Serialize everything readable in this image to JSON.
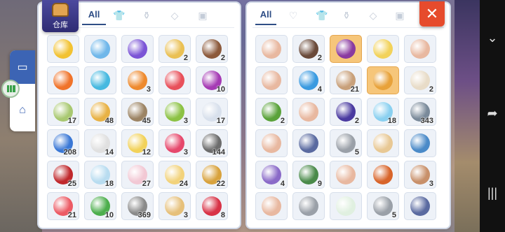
{
  "left_panel": {
    "badge_label": "仓库",
    "tabs": [
      {
        "label": "All",
        "active": true
      },
      {
        "icon": "shirt-icon"
      },
      {
        "icon": "potion-icon"
      },
      {
        "icon": "gem-icon"
      },
      {
        "icon": "card-icon"
      }
    ],
    "items": [
      {
        "color": "#f2c232",
        "qty": ""
      },
      {
        "color": "#6fb7ea",
        "qty": ""
      },
      {
        "color": "#7b54d6",
        "qty": ""
      },
      {
        "color": "#eac054",
        "qty": "2"
      },
      {
        "color": "#8c5a3c",
        "qty": "2"
      },
      {
        "color": "#f0732a",
        "qty": ""
      },
      {
        "color": "#46b9e0",
        "qty": ""
      },
      {
        "color": "#ee8a2e",
        "qty": "3"
      },
      {
        "color": "#e8505a",
        "qty": ""
      },
      {
        "color": "#a53ab4",
        "qty": "10"
      },
      {
        "color": "#a8c870",
        "qty": "17"
      },
      {
        "color": "#e8b245",
        "qty": "48"
      },
      {
        "color": "#9c8464",
        "qty": "45"
      },
      {
        "color": "#8cc244",
        "qty": "3"
      },
      {
        "color": "#d8e0ec",
        "qty": "17"
      },
      {
        "color": "#3a78d6",
        "qty": "208"
      },
      {
        "color": "#e0e0e0",
        "qty": "14"
      },
      {
        "color": "#f2d25a",
        "qty": "12"
      },
      {
        "color": "#e6486c",
        "qty": "3"
      },
      {
        "color": "#6c6c6c",
        "qty": "144"
      },
      {
        "color": "#c0282c",
        "qty": "25"
      },
      {
        "color": "#b8dcf0",
        "qty": "18"
      },
      {
        "color": "#f2c8d4",
        "qty": "27"
      },
      {
        "color": "#f2d27a",
        "qty": "24"
      },
      {
        "color": "#d8a23c",
        "qty": "22"
      },
      {
        "color": "#ec5a64",
        "qty": "21"
      },
      {
        "color": "#4cae4c",
        "qty": "10"
      },
      {
        "color": "#8a8a8a",
        "qty": "369"
      },
      {
        "color": "#e6c07a",
        "qty": "3"
      },
      {
        "color": "#d83246",
        "qty": "8"
      }
    ]
  },
  "right_panel": {
    "close_label": "✕",
    "tabs": [
      {
        "label": "All",
        "active": true
      },
      {
        "icon": "heart-icon"
      },
      {
        "icon": "shirt-icon"
      },
      {
        "icon": "potion-icon"
      },
      {
        "icon": "gem-icon"
      },
      {
        "icon": "card-icon"
      }
    ],
    "items": [
      {
        "color": "#e8b8a0",
        "qty": "",
        "hl": false
      },
      {
        "color": "#6a4a3a",
        "qty": "2",
        "hl": false
      },
      {
        "color": "#8a3aa0",
        "qty": "",
        "hl": true
      },
      {
        "color": "#f2d25a",
        "qty": "",
        "hl": false
      },
      {
        "color": "#e8b8a0",
        "qty": "",
        "hl": false
      },
      {
        "color": "#e8b8a0",
        "qty": "",
        "hl": false
      },
      {
        "color": "#3a9ae0",
        "qty": "4",
        "hl": false
      },
      {
        "color": "#c8a07a",
        "qty": "21",
        "hl": false
      },
      {
        "color": "#e8a23a",
        "qty": "",
        "hl": true
      },
      {
        "color": "#e8dcc8",
        "qty": "2",
        "hl": false
      },
      {
        "color": "#5aa23a",
        "qty": "2",
        "hl": false
      },
      {
        "color": "#e8b8a0",
        "qty": "",
        "hl": false
      },
      {
        "color": "#4a3aa0",
        "qty": "2",
        "hl": false
      },
      {
        "color": "#8ad0f0",
        "qty": "18",
        "hl": false
      },
      {
        "color": "#7a8a9a",
        "qty": "343",
        "hl": false
      },
      {
        "color": "#e8b8a0",
        "qty": "",
        "hl": false
      },
      {
        "color": "#5a6aa0",
        "qty": "",
        "hl": false
      },
      {
        "color": "#9aa0a8",
        "qty": "5",
        "hl": false
      },
      {
        "color": "#e8c894",
        "qty": "",
        "hl": false
      },
      {
        "color": "#4a8ac8",
        "qty": "",
        "hl": false
      },
      {
        "color": "#8a6ac8",
        "qty": "4",
        "hl": false
      },
      {
        "color": "#4a8a4a",
        "qty": "9",
        "hl": false
      },
      {
        "color": "#e8b8a0",
        "qty": "",
        "hl": false
      },
      {
        "color": "#d8642a",
        "qty": "",
        "hl": false
      },
      {
        "color": "#c8906a",
        "qty": "3",
        "hl": false
      },
      {
        "color": "#e8b8a0",
        "qty": "",
        "hl": false
      },
      {
        "color": "#9aa0a8",
        "qty": "",
        "hl": false
      },
      {
        "color": "#e0f0e0",
        "qty": "",
        "hl": false
      },
      {
        "color": "#9aa0a8",
        "qty": "5",
        "hl": false
      },
      {
        "color": "#5a6aa0",
        "qty": "",
        "hl": false
      }
    ]
  },
  "side_nav": {
    "items": [
      {
        "icon": "inbox-icon",
        "active": true
      },
      {
        "icon": "home-icon",
        "active": false
      }
    ]
  }
}
